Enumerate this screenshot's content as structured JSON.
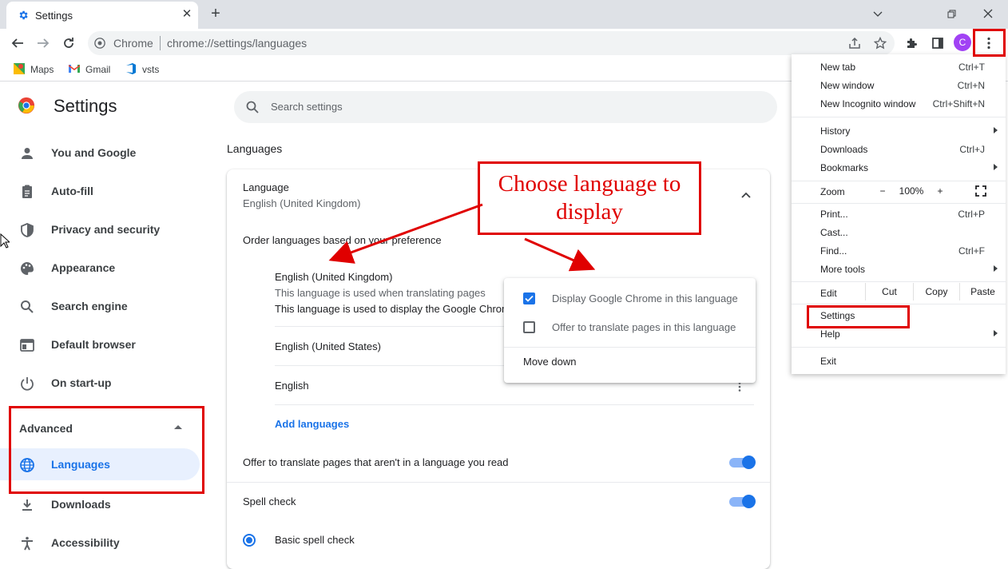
{
  "tab": {
    "title": "Settings",
    "favicon_icon": "gear-icon",
    "close_icon": "close-icon"
  },
  "new_tab_icon": "plus-icon",
  "window_controls": [
    "chevron-down-icon",
    "restore-icon",
    "close-icon"
  ],
  "toolbar": {
    "omnibox_label": "Chrome",
    "url": "chrome://settings/languages",
    "avatar_letter": "C",
    "icons": [
      "back-arrow-icon",
      "forward-arrow-icon",
      "reload-icon",
      "share-icon",
      "star-icon",
      "puzzle-icon",
      "side-panel-icon",
      "more-vertical-icon"
    ]
  },
  "bookmarks": [
    {
      "label": "Maps",
      "icon": "maps-icon"
    },
    {
      "label": "Gmail",
      "icon": "gmail-icon"
    },
    {
      "label": "vsts",
      "icon": "vsts-icon"
    }
  ],
  "header": {
    "title": "Settings",
    "search_placeholder": "Search settings"
  },
  "sidebar": {
    "items": [
      {
        "label": "You and Google",
        "icon": "person-icon"
      },
      {
        "label": "Auto-fill",
        "icon": "clipboard-icon"
      },
      {
        "label": "Privacy and security",
        "icon": "shield-icon"
      },
      {
        "label": "Appearance",
        "icon": "palette-icon"
      },
      {
        "label": "Search engine",
        "icon": "search-icon"
      },
      {
        "label": "Default browser",
        "icon": "browser-icon"
      },
      {
        "label": "On start-up",
        "icon": "power-icon"
      }
    ],
    "advanced_label": "Advanced",
    "advanced_items": [
      {
        "label": "Languages",
        "icon": "globe-icon",
        "active": true
      },
      {
        "label": "Downloads",
        "icon": "download-icon"
      },
      {
        "label": "Accessibility",
        "icon": "accessibility-icon"
      }
    ]
  },
  "main": {
    "section_title": "Languages",
    "language_heading": "Language",
    "language_value": "English (United Kingdom)",
    "order_label": "Order languages based on your preference",
    "languages": [
      {
        "name": "English (United Kingdom)",
        "notes": [
          "This language is used when translating pages",
          "This language is used to display the Google Chrom"
        ]
      },
      {
        "name": "English (United States)"
      },
      {
        "name": "English"
      }
    ],
    "add_languages": "Add languages",
    "offer_translate_label": "Offer to translate pages that aren't in a language you read",
    "offer_translate_on": true,
    "spell_check_label": "Spell check",
    "spell_check_on": true,
    "basic_spell_check": "Basic spell check"
  },
  "popup": {
    "display_label": "Display Google Chrome in this language",
    "display_checked": true,
    "offer_label": "Offer to translate pages in this language",
    "offer_checked": false,
    "move_down": "Move down"
  },
  "menu": {
    "new_tab": "New tab",
    "new_tab_sc": "Ctrl+T",
    "new_window": "New window",
    "new_window_sc": "Ctrl+N",
    "new_incognito": "New Incognito window",
    "new_incognito_sc": "Ctrl+Shift+N",
    "history": "History",
    "downloads": "Downloads",
    "downloads_sc": "Ctrl+J",
    "bookmarks": "Bookmarks",
    "zoom": "Zoom",
    "zoom_minus": "−",
    "zoom_level": "100%",
    "zoom_plus": "+",
    "print": "Print...",
    "print_sc": "Ctrl+P",
    "cast": "Cast...",
    "find": "Find...",
    "find_sc": "Ctrl+F",
    "more_tools": "More tools",
    "edit": "Edit",
    "cut": "Cut",
    "copy": "Copy",
    "paste": "Paste",
    "settings": "Settings",
    "help": "Help",
    "exit": "Exit"
  },
  "annotation": {
    "callout_text": "Choose language to display",
    "color": "#e00000"
  }
}
